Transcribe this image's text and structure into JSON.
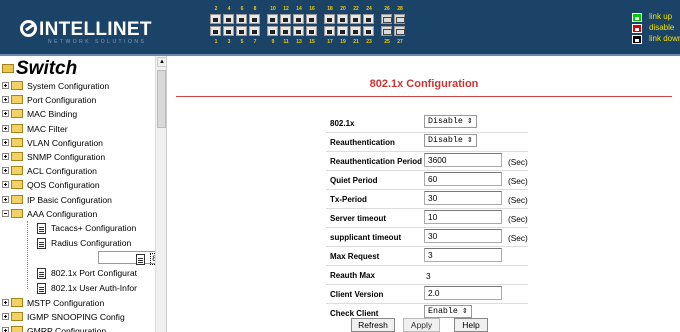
{
  "brand": {
    "logo": "INTELLINET",
    "tagline": "NETWORK SOLUTIONS"
  },
  "ports": {
    "top_numbers": [
      "2",
      "4",
      "6",
      "8",
      "10",
      "12",
      "14",
      "16",
      "18",
      "20",
      "22",
      "24",
      "26",
      "28"
    ],
    "bottom_numbers": [
      "1",
      "3",
      "5",
      "7",
      "9",
      "11",
      "13",
      "15",
      "17",
      "19",
      "21",
      "23",
      "25",
      "27"
    ]
  },
  "legend": {
    "items": [
      "link up",
      "disable",
      "link down"
    ],
    "colors": {
      "link_up": "#00cc00",
      "disable": "#dd0000",
      "link_down": "#000000"
    }
  },
  "tree": {
    "root": "Switch",
    "items": [
      "System Configuration",
      "Port Configuration",
      "MAC Binding",
      "MAC Filter",
      "VLAN Configuration",
      "SNMP Configuration",
      "ACL Configuration",
      "QOS Configuration",
      "IP Basic Configuration",
      "AAA Configuration"
    ],
    "aaa_children": [
      "Tacacs+ Configuration",
      "Radius Configuration",
      "802.1x Configuration",
      "802.1x Port Configurat",
      "802.1x User Auth-Infor"
    ],
    "after": [
      "MSTP Configuration",
      "IGMP SNOOPING Config",
      "GMRP Configuration"
    ]
  },
  "page": {
    "title": "802.1x Configuration"
  },
  "form": {
    "dot1x": {
      "label": "802.1x",
      "value": "Disable"
    },
    "reauth": {
      "label": "Reauthentication",
      "value": "Disable"
    },
    "reauth_period": {
      "label": "Reauthentication Period",
      "value": "3600",
      "unit": "(Sec)"
    },
    "quiet_period": {
      "label": "Quiet Period",
      "value": "60",
      "unit": "(Sec)"
    },
    "tx_period": {
      "label": "Tx-Period",
      "value": "30",
      "unit": "(Sec)"
    },
    "server_timeout": {
      "label": "Server timeout",
      "value": "10",
      "unit": "(Sec)"
    },
    "supplicant_timeout": {
      "label": "supplicant timeout",
      "value": "30",
      "unit": "(Sec)"
    },
    "max_request": {
      "label": "Max Request",
      "value": "3"
    },
    "reauth_max": {
      "label": "Reauth Max",
      "value": "3"
    },
    "client_version": {
      "label": "Client Version",
      "value": "2.0"
    },
    "check_client": {
      "label": "Check Client",
      "value": "Enable"
    }
  },
  "buttons": {
    "refresh": "Refresh",
    "apply": "Apply",
    "help": "Help"
  },
  "colors": {
    "header_bg": "#1b4267",
    "title_red": "#cc3333",
    "port_number": "#f0d000"
  }
}
